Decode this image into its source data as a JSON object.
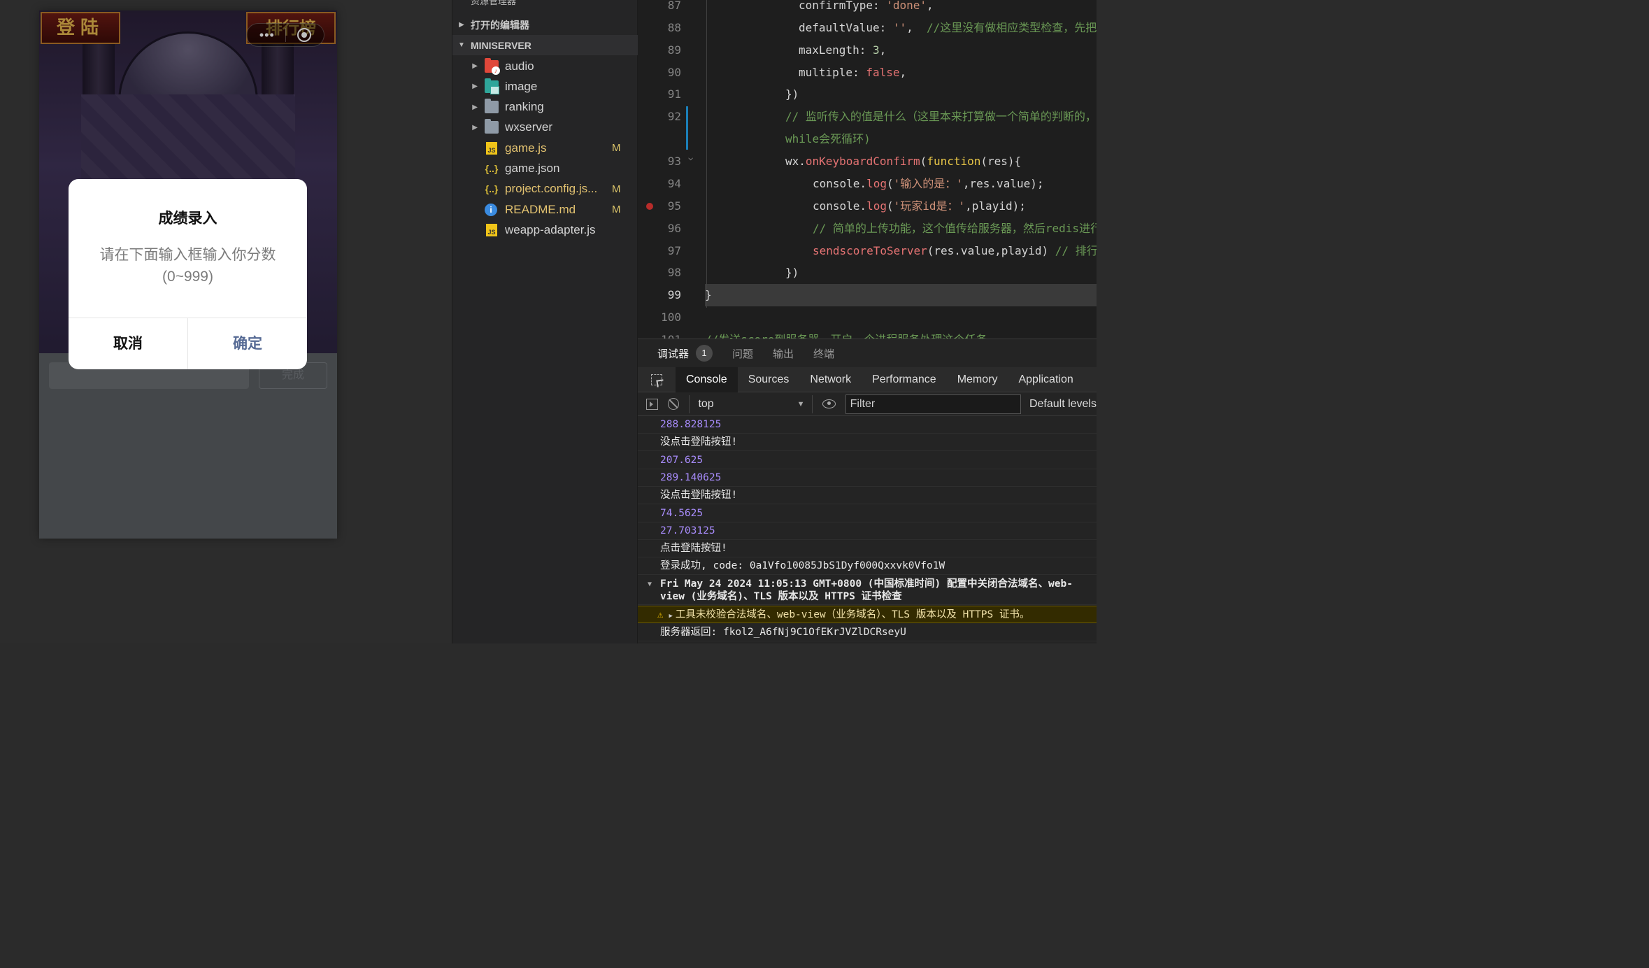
{
  "simulator": {
    "login_button": "登陆",
    "ranking_button": "排行榜",
    "keyboard_done": "完成",
    "modal": {
      "title": "成绩录入",
      "content": "请在下面输入框输入你分数(0~999)",
      "cancel": "取消",
      "confirm": "确定"
    }
  },
  "explorer": {
    "title": "资源管理器",
    "open_editors": "打开的编辑器",
    "project": "MINISERVER",
    "items": [
      {
        "name": "audio",
        "type": "folder",
        "icon": "audio-folder-icon",
        "modified": ""
      },
      {
        "name": "image",
        "type": "folder",
        "icon": "image-folder-icon",
        "modified": ""
      },
      {
        "name": "ranking",
        "type": "folder",
        "icon": "folder-icon",
        "modified": ""
      },
      {
        "name": "wxserver",
        "type": "folder",
        "icon": "folder-icon",
        "modified": ""
      },
      {
        "name": "game.js",
        "type": "js",
        "icon": "js-file-icon",
        "modified": "M"
      },
      {
        "name": "game.json",
        "type": "json",
        "icon": "json-file-icon",
        "modified": ""
      },
      {
        "name": "project.config.js...",
        "type": "json",
        "icon": "json-file-icon",
        "modified": "M"
      },
      {
        "name": "README.md",
        "type": "md",
        "icon": "info-icon",
        "modified": "M"
      },
      {
        "name": "weapp-adapter.js",
        "type": "js",
        "icon": "js-file-icon",
        "modified": ""
      }
    ]
  },
  "editor": {
    "lines": [
      {
        "no": "87",
        "text": "confirmType: 'done',"
      },
      {
        "no": "88",
        "text": "defaultValue: '',  //这里没有做相应类型检查，先把"
      },
      {
        "no": "89",
        "text": "maxLength: 3,"
      },
      {
        "no": "90",
        "text": "multiple: false,"
      },
      {
        "no": "91",
        "text": "})"
      },
      {
        "no": "92",
        "text": "// 监听传入的值是什么（这里本来打算做一个简单的判断的，"
      },
      {
        "no": "",
        "text": "while会死循环)"
      },
      {
        "no": "93",
        "text": "wx.onKeyboardConfirm(function(res){"
      },
      {
        "no": "94",
        "text": "console.log('输入的是：',res.value);"
      },
      {
        "no": "95",
        "text": "console.log('玩家id是：',playid);"
      },
      {
        "no": "96",
        "text": "// 简单的上传功能，这个值传给服务器，然后redis进行"
      },
      {
        "no": "97",
        "text": "sendscoreToServer(res.value,playid) // 排行"
      },
      {
        "no": "98",
        "text": "})"
      },
      {
        "no": "99",
        "text": "}"
      },
      {
        "no": "100",
        "text": ""
      },
      {
        "no": "101",
        "text": "//发送score到服务器，开启一个进程服务处理这个任务"
      }
    ]
  },
  "panel": {
    "tabs": [
      "调试器",
      "问题",
      "输出",
      "终端"
    ],
    "debugger_badge": "1",
    "devtools_tabs": [
      "Console",
      "Sources",
      "Network",
      "Performance",
      "Memory",
      "Application"
    ],
    "context": "top",
    "filter_placeholder": "Filter",
    "levels": "Default levels",
    "logs": [
      {
        "text": "288.828125",
        "kind": "num"
      },
      {
        "text": "没点击登陆按钮!",
        "kind": "text"
      },
      {
        "text": "207.625",
        "kind": "num"
      },
      {
        "text": "289.140625",
        "kind": "num"
      },
      {
        "text": "没点击登陆按钮!",
        "kind": "text"
      },
      {
        "text": "74.5625",
        "kind": "num"
      },
      {
        "text": "27.703125",
        "kind": "num"
      },
      {
        "text": "点击登陆按钮!",
        "kind": "text"
      },
      {
        "text": "登录成功, code: 0a1Vfo10085JbS1Dyf000Qxxvk0Vfo1W",
        "kind": "text"
      },
      {
        "text": "Fri May 24 2024 11:05:13 GMT+0800 (中国标准时间) 配置中关闭合法域名、web-view (业务域名)、TLS 版本以及 HTTPS 证书检查",
        "kind": "group"
      },
      {
        "text": "工具未校验合法域名、web-view（业务域名）、TLS 版本以及 HTTPS 证书。",
        "kind": "warn"
      },
      {
        "text": "服务器返回: fkol2_A6fNj9C1OfEKrJVZlDCRseyU",
        "kind": "text"
      }
    ]
  }
}
